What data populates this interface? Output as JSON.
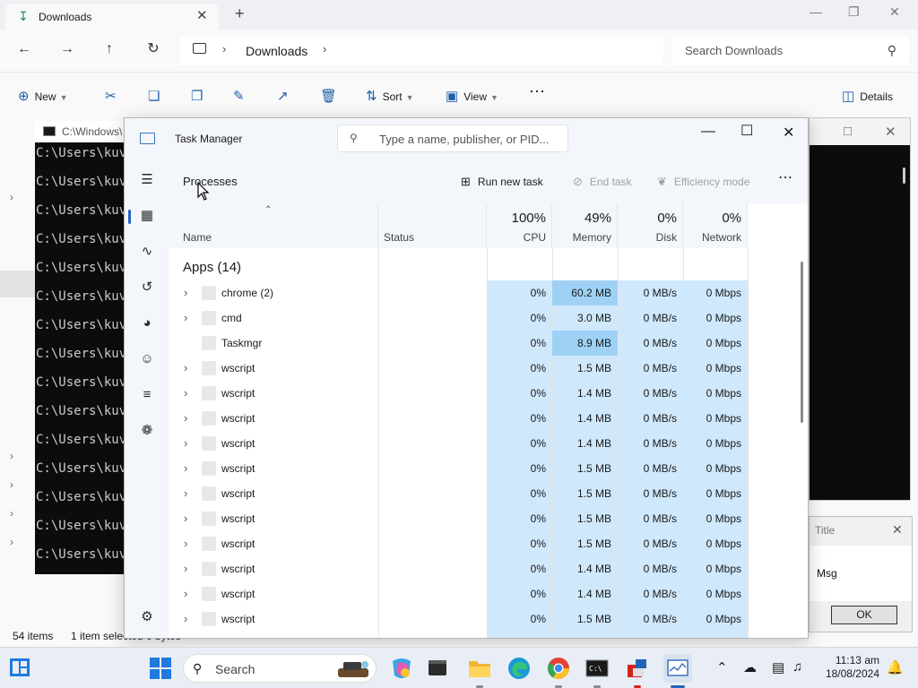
{
  "explorer": {
    "tab_title": "Downloads",
    "breadcrumb": "Downloads",
    "search_placeholder": "Search Downloads",
    "toolbar": {
      "new_label": "New",
      "sort_label": "Sort",
      "view_label": "View",
      "details_label": "Details"
    },
    "status": {
      "items": "54 items",
      "selected": "1 item selected  0 bytes"
    }
  },
  "cmd": {
    "title": "C:\\Windows\\",
    "lines": [
      "C:\\Users\\kuve",
      "C:\\Users\\kuve",
      "C:\\Users\\kuve",
      "C:\\Users\\kuve",
      "C:\\Users\\kuve",
      "C:\\Users\\kuve",
      "C:\\Users\\kuve",
      "C:\\Users\\kuve",
      "C:\\Users\\kuve",
      "C:\\Users\\kuve",
      "C:\\Users\\kuve",
      "C:\\Users\\kuve",
      "C:\\Users\\kuve",
      "C:\\Users\\kuve",
      "C:\\Users\\kuve"
    ]
  },
  "msgbox": {
    "title": "Title",
    "message": "Msg",
    "ok_label": "OK"
  },
  "taskmgr": {
    "title": "Task Manager",
    "search_placeholder": "Type a name, publisher, or PID...",
    "page_title": "Processes",
    "actions": {
      "run_new_task": "Run new task",
      "end_task": "End task",
      "efficiency_mode": "Efficiency mode"
    },
    "columns": {
      "name": "Name",
      "status": "Status",
      "cpu": {
        "pct": "100%",
        "label": "CPU"
      },
      "memory": {
        "pct": "49%",
        "label": "Memory"
      },
      "disk": {
        "pct": "0%",
        "label": "Disk"
      },
      "network": {
        "pct": "0%",
        "label": "Network"
      }
    },
    "group_title": "Apps (14)",
    "rows": [
      {
        "name": "chrome (2)",
        "expandable": true,
        "cpu": "0%",
        "memory": "60.2 MB",
        "disk": "0 MB/s",
        "network": "0 Mbps",
        "mem_highlight": true
      },
      {
        "name": "cmd",
        "expandable": true,
        "cpu": "0%",
        "memory": "3.0 MB",
        "disk": "0 MB/s",
        "network": "0 Mbps",
        "mem_highlight": false
      },
      {
        "name": "Taskmgr",
        "expandable": false,
        "cpu": "0%",
        "memory": "8.9 MB",
        "disk": "0 MB/s",
        "network": "0 Mbps",
        "mem_highlight": true
      },
      {
        "name": "wscript",
        "expandable": true,
        "cpu": "0%",
        "memory": "1.5 MB",
        "disk": "0 MB/s",
        "network": "0 Mbps",
        "mem_highlight": false
      },
      {
        "name": "wscript",
        "expandable": true,
        "cpu": "0%",
        "memory": "1.4 MB",
        "disk": "0 MB/s",
        "network": "0 Mbps",
        "mem_highlight": false
      },
      {
        "name": "wscript",
        "expandable": true,
        "cpu": "0%",
        "memory": "1.4 MB",
        "disk": "0 MB/s",
        "network": "0 Mbps",
        "mem_highlight": false
      },
      {
        "name": "wscript",
        "expandable": true,
        "cpu": "0%",
        "memory": "1.4 MB",
        "disk": "0 MB/s",
        "network": "0 Mbps",
        "mem_highlight": false
      },
      {
        "name": "wscript",
        "expandable": true,
        "cpu": "0%",
        "memory": "1.5 MB",
        "disk": "0 MB/s",
        "network": "0 Mbps",
        "mem_highlight": false
      },
      {
        "name": "wscript",
        "expandable": true,
        "cpu": "0%",
        "memory": "1.5 MB",
        "disk": "0 MB/s",
        "network": "0 Mbps",
        "mem_highlight": false
      },
      {
        "name": "wscript",
        "expandable": true,
        "cpu": "0%",
        "memory": "1.5 MB",
        "disk": "0 MB/s",
        "network": "0 Mbps",
        "mem_highlight": false
      },
      {
        "name": "wscript",
        "expandable": true,
        "cpu": "0%",
        "memory": "1.5 MB",
        "disk": "0 MB/s",
        "network": "0 Mbps",
        "mem_highlight": false
      },
      {
        "name": "wscript",
        "expandable": true,
        "cpu": "0%",
        "memory": "1.4 MB",
        "disk": "0 MB/s",
        "network": "0 Mbps",
        "mem_highlight": false
      },
      {
        "name": "wscript",
        "expandable": true,
        "cpu": "0%",
        "memory": "1.4 MB",
        "disk": "0 MB/s",
        "network": "0 Mbps",
        "mem_highlight": false
      },
      {
        "name": "wscript",
        "expandable": true,
        "cpu": "0%",
        "memory": "1.5 MB",
        "disk": "0 MB/s",
        "network": "0 Mbps",
        "mem_highlight": false
      }
    ]
  },
  "taskbar": {
    "search_placeholder": "Search",
    "time": "11:13 am",
    "date": "18/08/2024"
  },
  "colors": {
    "accent": "#1f7ae0",
    "heat_light": "#cfe8fc",
    "heat_strong": "#9fd1f7"
  }
}
